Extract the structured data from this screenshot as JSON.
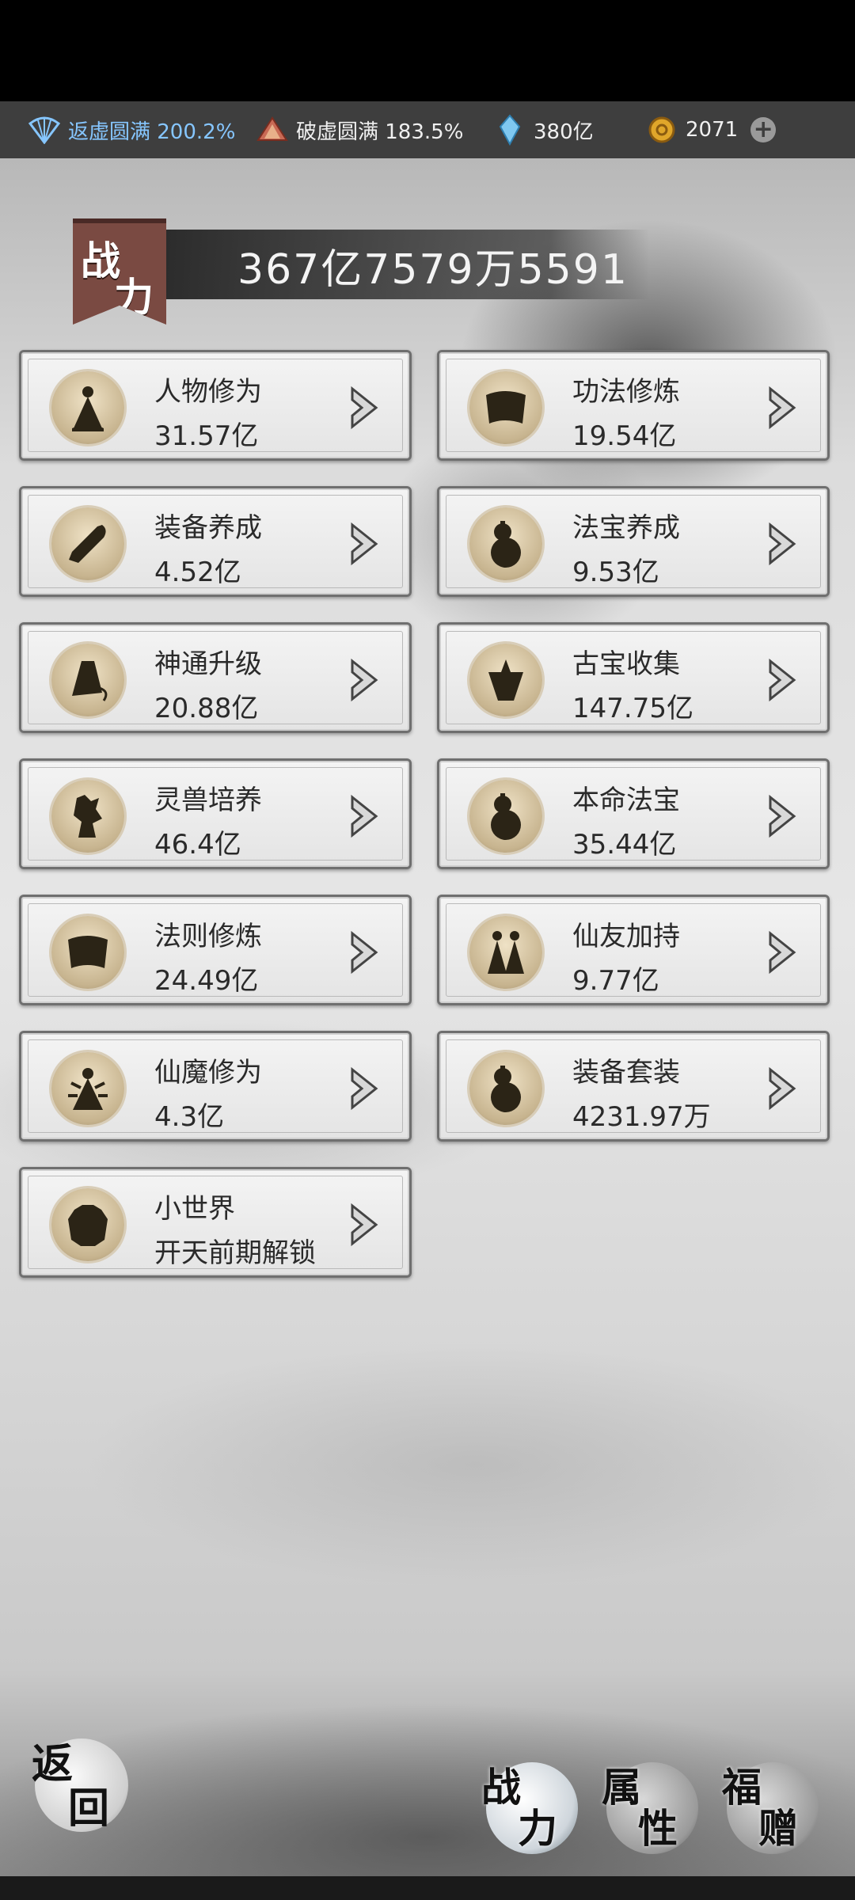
{
  "resources": [
    {
      "icon": "fan-icon",
      "label": "返虚圆满 200.2%"
    },
    {
      "icon": "crystal-icon",
      "label": "破虚圆满 183.5%"
    },
    {
      "icon": "spirit-stone-icon",
      "label": "380亿"
    },
    {
      "icon": "gold-coin-icon",
      "label": "2071"
    }
  ],
  "power": {
    "badge_top": "战",
    "badge_bottom": "力",
    "value": "367亿7579万5591"
  },
  "cards": [
    {
      "title": "人物修为",
      "value": "31.57亿",
      "icon": "cultivator-icon"
    },
    {
      "title": "功法修炼",
      "value": "19.54亿",
      "icon": "scroll-icon"
    },
    {
      "title": "装备养成",
      "value": "4.52亿",
      "icon": "sword-icon"
    },
    {
      "title": "法宝养成",
      "value": "9.53亿",
      "icon": "gourd-icon"
    },
    {
      "title": "神通升级",
      "value": "20.88亿",
      "icon": "bell-icon"
    },
    {
      "title": "古宝收集",
      "value": "147.75亿",
      "icon": "treasure-bag-icon"
    },
    {
      "title": "灵兽培养",
      "value": "46.4亿",
      "icon": "beast-icon"
    },
    {
      "title": "本命法宝",
      "value": "35.44亿",
      "icon": "gourd-icon"
    },
    {
      "title": "法则修炼",
      "value": "24.49亿",
      "icon": "scroll-icon"
    },
    {
      "title": "仙友加持",
      "value": "9.77亿",
      "icon": "companions-icon"
    },
    {
      "title": "仙魔修为",
      "value": "4.3亿",
      "icon": "demon-icon"
    },
    {
      "title": "装备套装",
      "value": "4231.97万",
      "icon": "gourd-icon"
    },
    {
      "title": "小世界",
      "value": "开天前期解锁",
      "icon": "world-icon"
    }
  ],
  "back": {
    "c1": "返",
    "c2": "回"
  },
  "nav": [
    {
      "c1": "战",
      "c2": "力"
    },
    {
      "c1": "属",
      "c2": "性"
    },
    {
      "c1": "福",
      "c2": "赠"
    }
  ]
}
